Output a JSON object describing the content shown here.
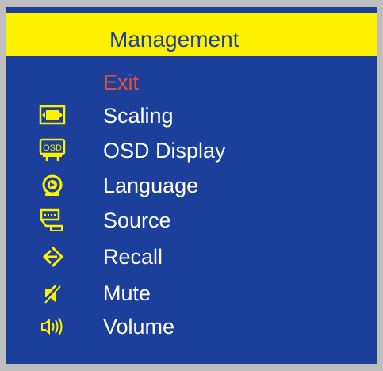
{
  "osd": {
    "title": "Management",
    "colors": {
      "panel": "#1b3f9a",
      "title_bar": "#fff200",
      "frame": "#bebebe",
      "item_text": "#ffffff",
      "exit_text": "#e0503a",
      "icon": "#fff200"
    },
    "items": [
      {
        "label": "Exit",
        "icon": ""
      },
      {
        "label": "Scaling",
        "icon": "scaling-icon"
      },
      {
        "label": "OSD Display",
        "icon": "osd-display-icon"
      },
      {
        "label": "Language",
        "icon": "language-icon"
      },
      {
        "label": "Source",
        "icon": "source-icon"
      },
      {
        "label": "Recall",
        "icon": "recall-icon"
      },
      {
        "label": "Mute",
        "icon": "mute-icon"
      },
      {
        "label": "Volume",
        "icon": "volume-icon"
      }
    ],
    "osd_icon_text": "OSD"
  }
}
